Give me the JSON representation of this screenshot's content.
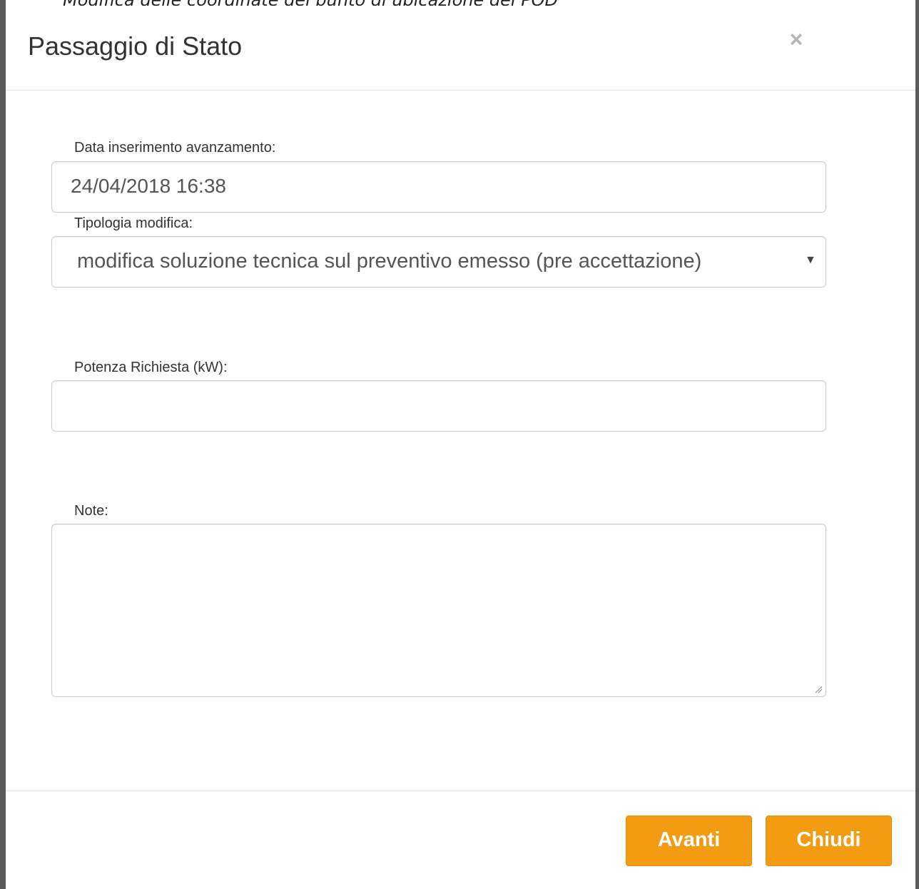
{
  "background": {
    "partial_text": "Modifica delle coordinate del punto di ubicazione del POD"
  },
  "modal": {
    "title": "Passaggio di Stato",
    "close_symbol": "×",
    "fields": {
      "data_label": "Data inserimento avanzamento:",
      "data_value": "24/04/2018 16:38",
      "tipologia_label": "Tipologia modifica:",
      "tipologia_selected": "modifica soluzione tecnica sul preventivo emesso (pre accettazione)",
      "potenza_label": "Potenza Richiesta (kW):",
      "potenza_value": "",
      "note_label": "Note:",
      "note_value": ""
    },
    "buttons": {
      "avanti": "Avanti",
      "chiudi": "Chiudi"
    }
  },
  "colors": {
    "button_bg": "#f39c12",
    "title": "#333333",
    "border": "#cccccc"
  }
}
